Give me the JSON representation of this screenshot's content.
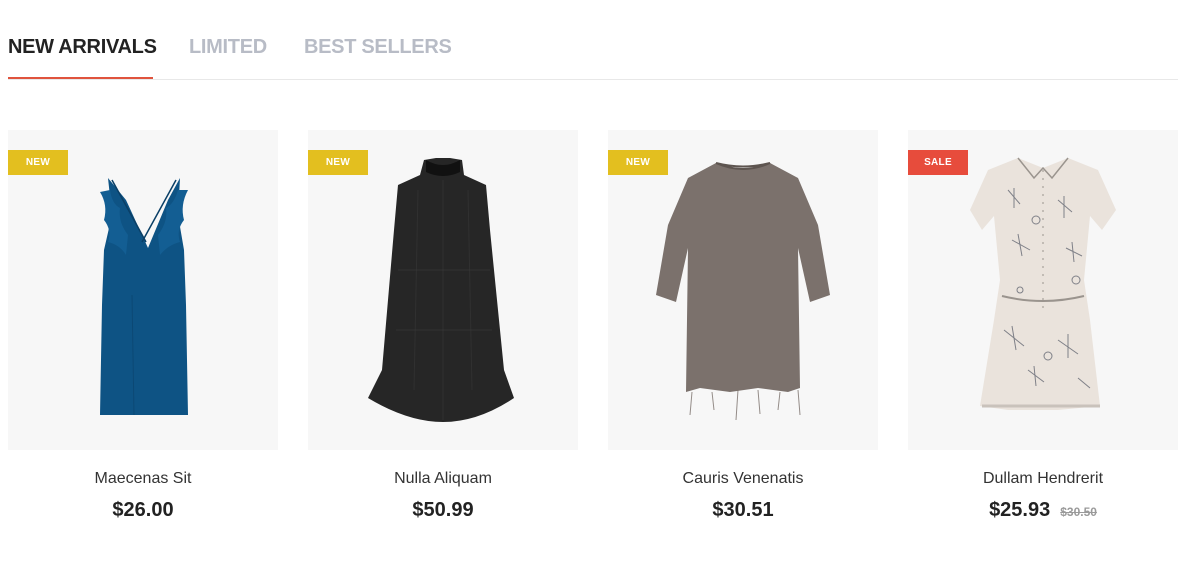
{
  "tabs": [
    {
      "label": "NEW ARRIVALS",
      "active": true
    },
    {
      "label": "LIMITED",
      "active": false
    },
    {
      "label": "BEST SELLERS",
      "active": false
    }
  ],
  "colors": {
    "accent": "#e0533d",
    "badge_new": "#e3bf1f",
    "badge_sale": "#e74c3c",
    "tab_inactive": "#b8bcc6"
  },
  "products": [
    {
      "name": "Maecenas Sit",
      "price": "$26.00",
      "old_price": "",
      "badge": "NEW",
      "image": "blue-ruffle-dress"
    },
    {
      "name": "Nulla Aliquam",
      "price": "$50.99",
      "old_price": "",
      "badge": "NEW",
      "image": "black-sleeveless-dress"
    },
    {
      "name": "Cauris Venenatis",
      "price": "$30.51",
      "old_price": "",
      "badge": "NEW",
      "image": "grey-tunic-dress"
    },
    {
      "name": "Dullam Hendrerit",
      "price": "$25.93",
      "old_price": "$30.50",
      "badge": "SALE",
      "image": "printed-shirt-dress"
    }
  ]
}
